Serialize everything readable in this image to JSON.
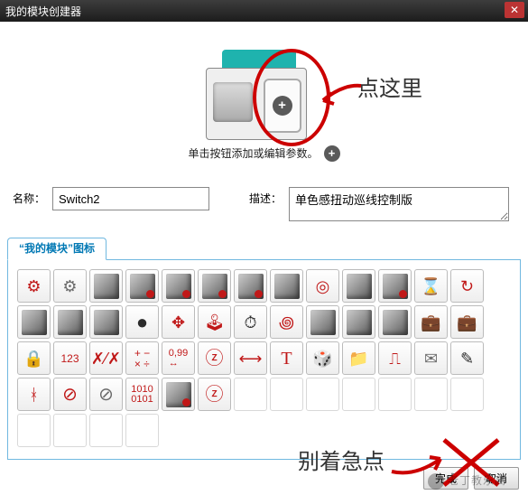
{
  "window": {
    "title": "我的模块创建器"
  },
  "preview": {
    "hint": "单击按钮添加或编辑参数。"
  },
  "annotations": {
    "clickHere": "点这里",
    "dontRush": "别着急点"
  },
  "form": {
    "nameLabel": "名称：",
    "nameValue": "Switch2",
    "descLabel": "描述：",
    "descValue": "单色感扭动巡线控制版"
  },
  "tabs": [
    {
      "label": "“我的模块”图标"
    }
  ],
  "footer": {
    "finish": "完成",
    "cancel": "取消"
  },
  "watermark": {
    "text": "老丁教乐高"
  },
  "icons": {
    "row1": [
      "gears-red",
      "gears-grey",
      "motor",
      "motor-red",
      "dual-motor",
      "dual-motor-alt",
      "motor-group",
      "motor-group-alt",
      "target",
      "brick",
      "brick-button",
      "hourglass",
      "loop",
      "robot"
    ],
    "row2": [
      "cube",
      "cube-alt",
      "disc",
      "dpad",
      "joystick",
      "stopwatch",
      "spinner",
      "sensor",
      "sensor-alt",
      "device",
      "briefcase",
      "briefcase-alt",
      "lock",
      "digits-123"
    ],
    "row3": [
      "math-xx",
      "operators",
      "decimal-0.99",
      "circle-z",
      "width-arrow",
      "text-T",
      "dice",
      "folder",
      "pulse",
      "envelope",
      "pencil",
      "bluetooth",
      "no-bluetooth",
      "prohibited"
    ],
    "row4": [
      "binary-1010-0101",
      "part",
      "circle-z",
      "",
      "",
      "",
      "",
      "",
      "",
      "",
      "",
      "",
      "",
      ""
    ]
  }
}
